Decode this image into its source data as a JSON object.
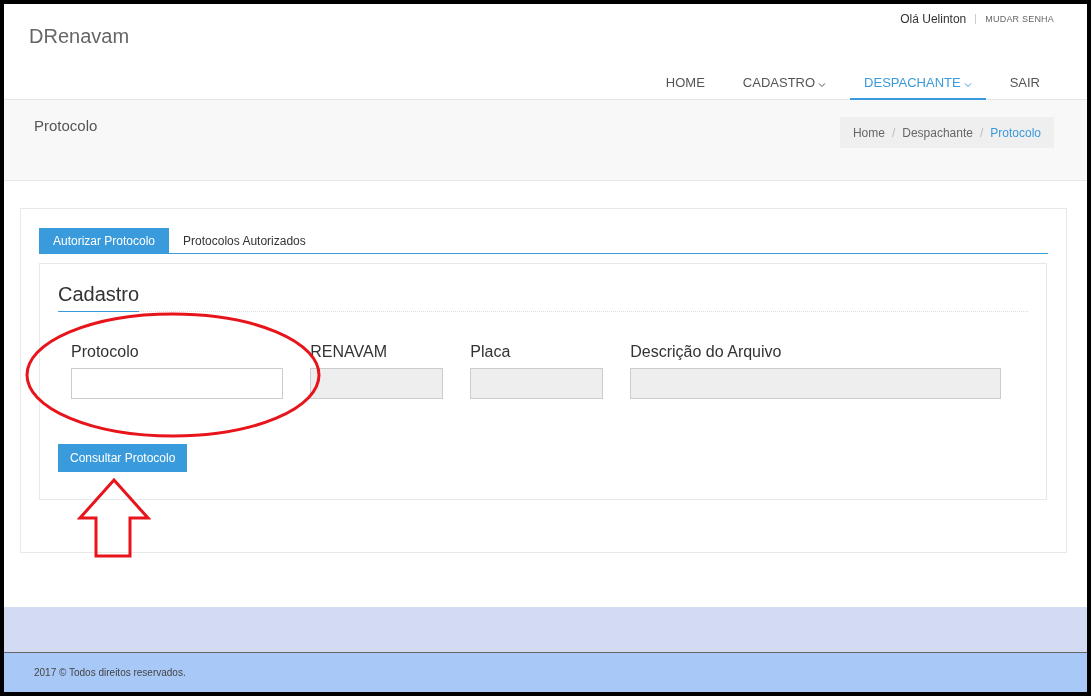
{
  "header": {
    "logo": "DRenavam",
    "greeting": "Olá Uelinton",
    "account_link": "MUDAR SENHA"
  },
  "nav": [
    {
      "label": "HOME",
      "dropdown": false,
      "selected": false
    },
    {
      "label": "CADASTRO",
      "dropdown": true,
      "selected": false
    },
    {
      "label": "DESPACHANTE",
      "dropdown": true,
      "selected": true
    },
    {
      "label": "SAIR",
      "dropdown": false,
      "selected": false
    }
  ],
  "page_title": "Protocolo",
  "breadcrumb_separator": "/",
  "breadcrumb": [
    {
      "label": "Home",
      "selected": false
    },
    {
      "label": "Despachante",
      "selected": false
    },
    {
      "label": "Protocolo",
      "selected": true
    }
  ],
  "tabs": [
    {
      "label": "Autorizar Protocolo",
      "selected": true
    },
    {
      "label": "Protocolos Autorizados",
      "selected": false
    }
  ],
  "form": {
    "heading": "Cadastro",
    "fields": [
      {
        "label": "Protocolo",
        "disabled": false
      },
      {
        "label": "RENAVAM",
        "disabled": true
      },
      {
        "label": "Placa",
        "disabled": true
      },
      {
        "label": "Descrição do Arquivo",
        "disabled": true
      }
    ],
    "button": "Consultar Protocolo"
  },
  "footer": "2017 © Todos direitos reservados."
}
